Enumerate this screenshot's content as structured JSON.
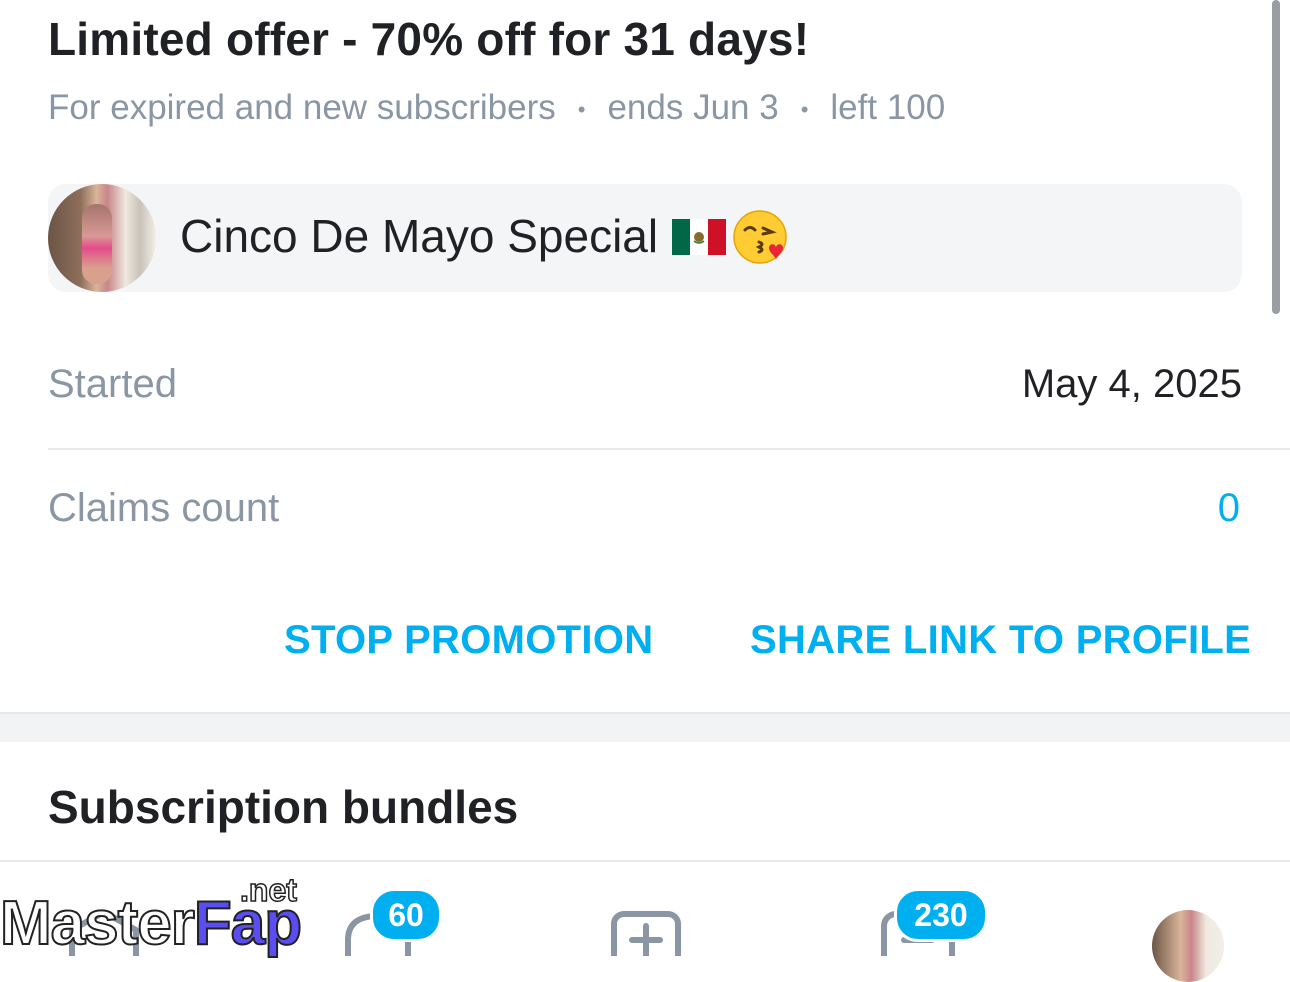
{
  "offer": {
    "title": "Limited offer - 70% off for 31 days!",
    "audience": "For expired and new subscribers",
    "separator": "•",
    "ends": "ends Jun 3",
    "left": "left 100"
  },
  "promo": {
    "message": "Cinco De Mayo Special",
    "flag_icon": "mexico-flag-icon",
    "emoji_icon": "kissing-face-with-heart-icon"
  },
  "details": {
    "started_label": "Started",
    "started_value": "May 4, 2025",
    "claims_label": "Claims count",
    "claims_value": "0"
  },
  "actions": {
    "stop": "STOP PROMOTION",
    "share": "SHARE LINK TO PROFILE"
  },
  "section": {
    "title": "Subscription bundles"
  },
  "bottom_nav": {
    "notifications_badge": "60",
    "messages_badge": "230",
    "icons": [
      "home-icon",
      "notifications-icon",
      "add-post-icon",
      "messages-icon",
      "profile-avatar"
    ]
  },
  "watermark": {
    "part1": "Master",
    "part2": "Fap",
    "suffix": ".net"
  },
  "colors": {
    "accent": "#00aff0",
    "muted": "#8a96a3",
    "text": "#1f2125"
  }
}
